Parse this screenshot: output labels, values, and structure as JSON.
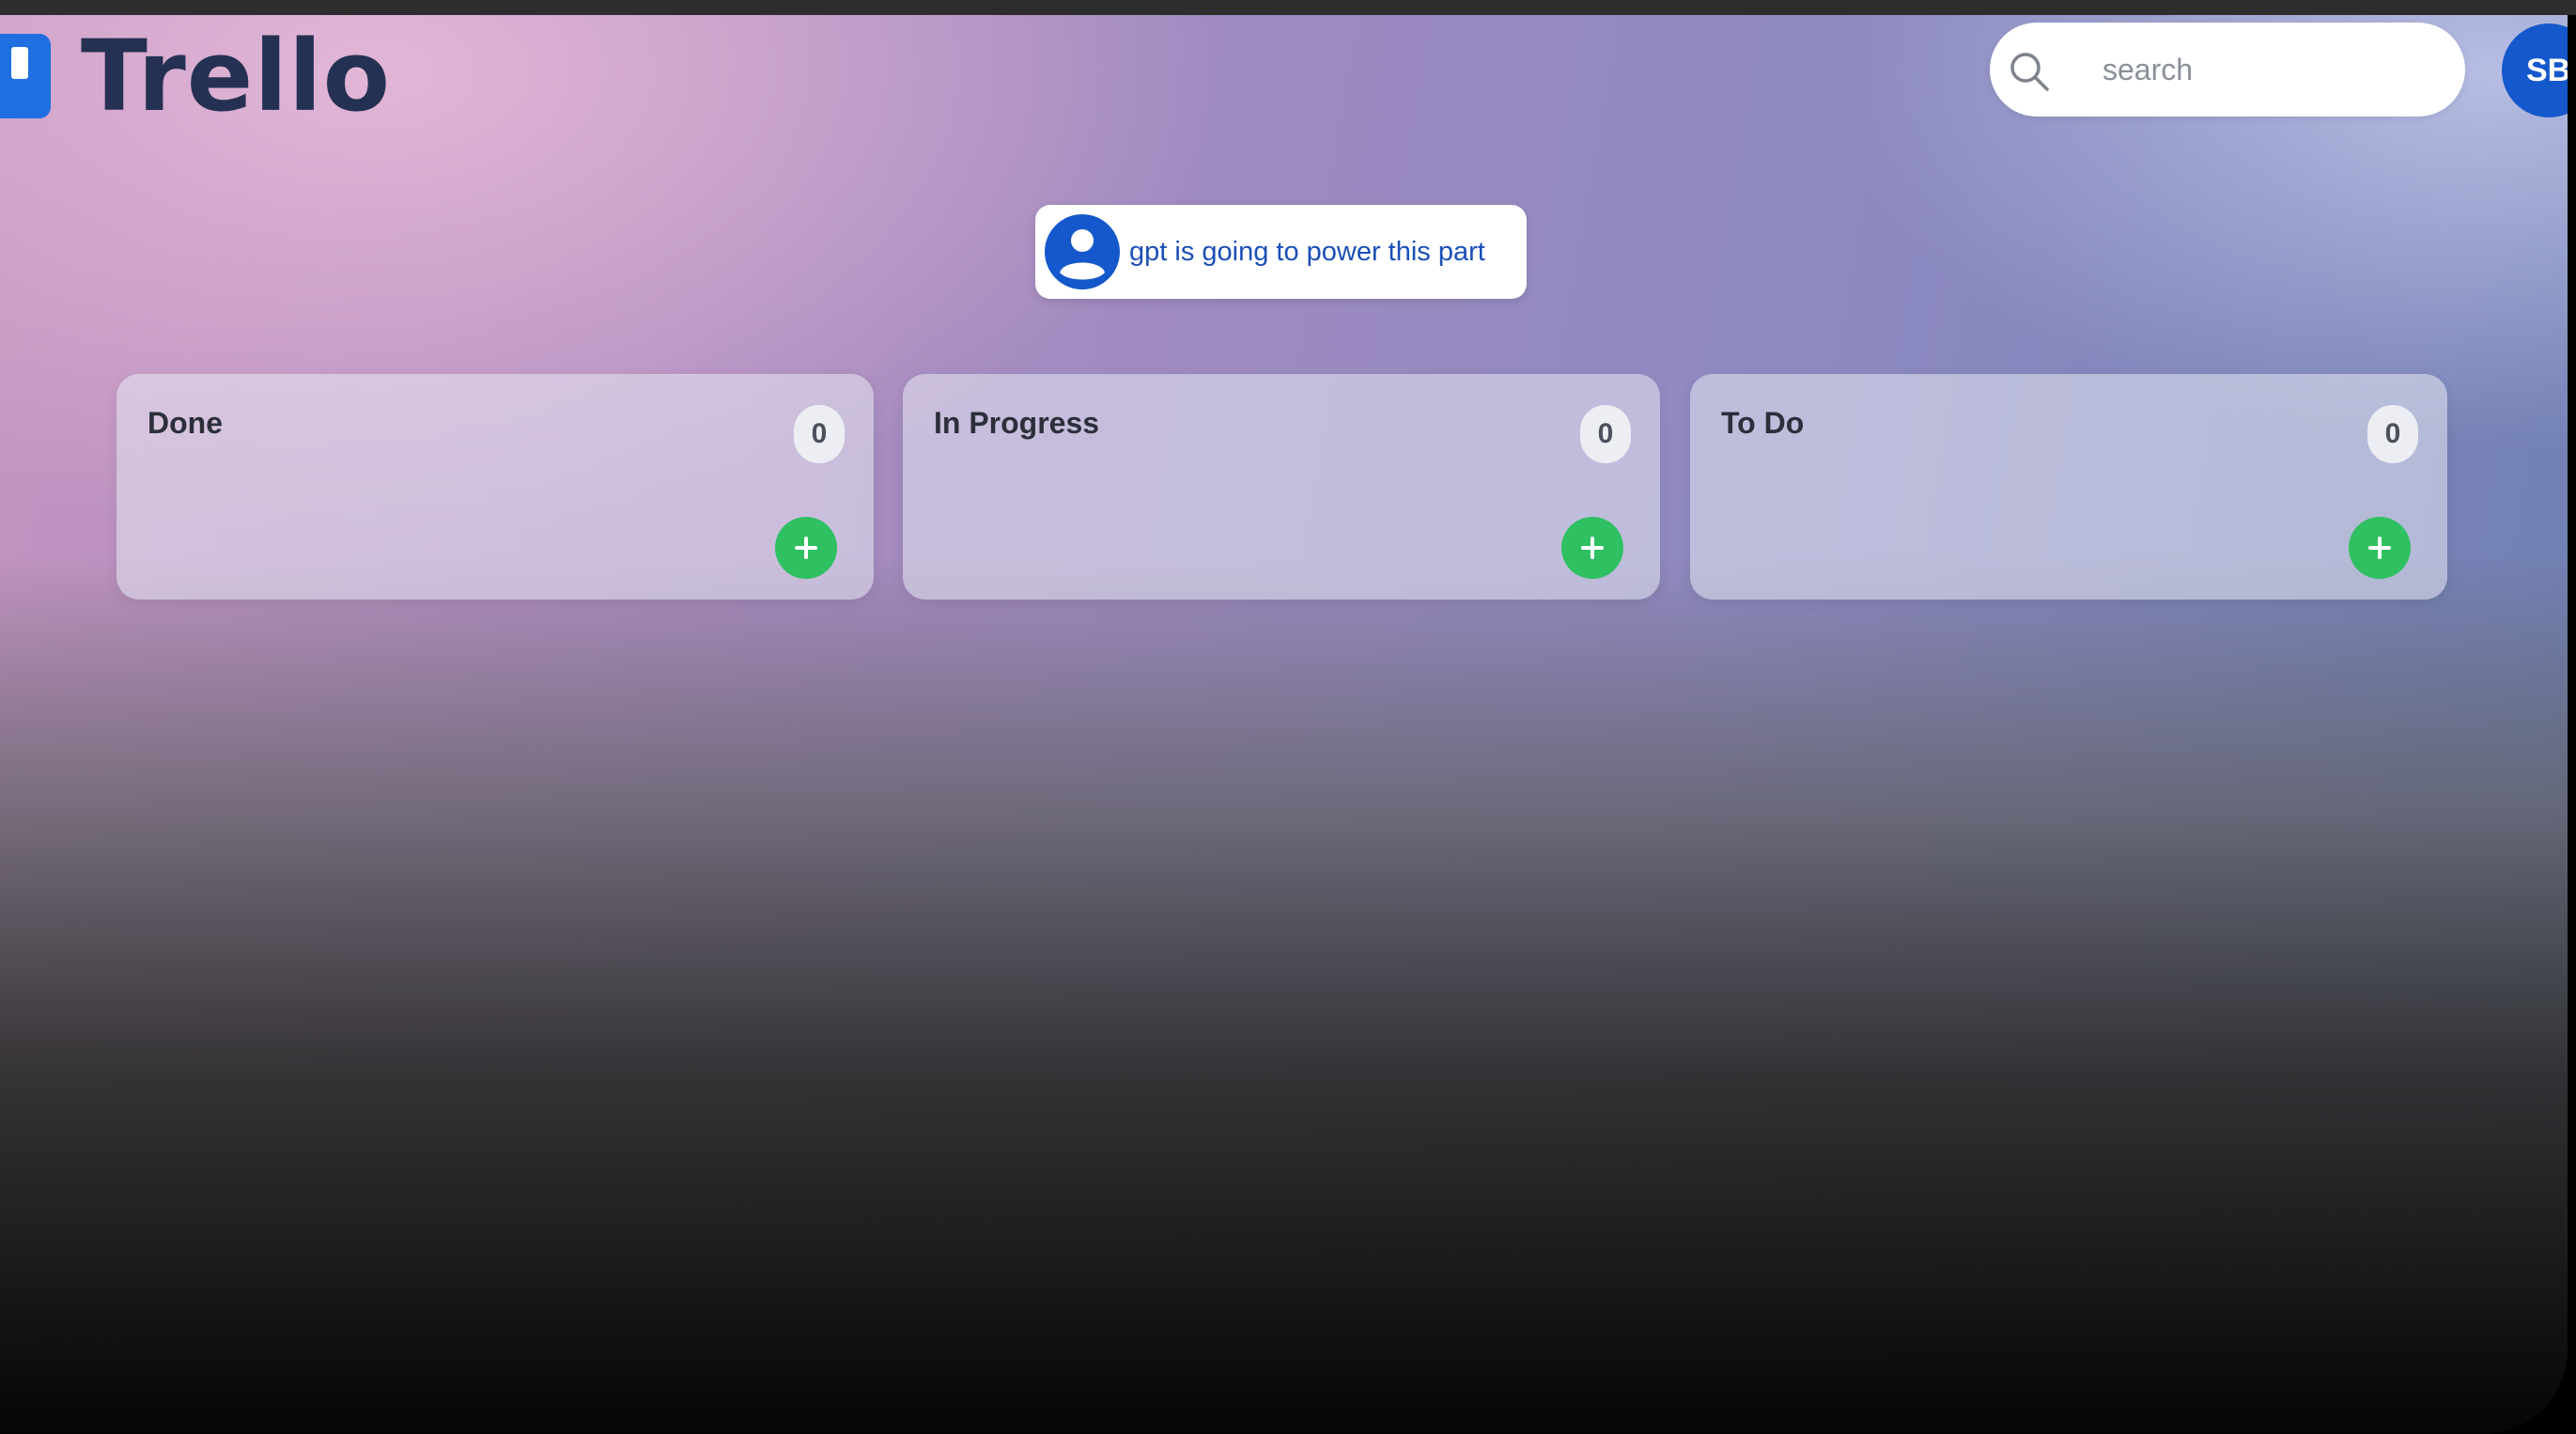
{
  "app": {
    "logo_text": "Trello"
  },
  "header": {
    "search_placeholder": "search",
    "avatar_initials": "SB"
  },
  "banner": {
    "text": "gpt is going to power this part"
  },
  "columns": [
    {
      "title": "Done",
      "count": "0"
    },
    {
      "title": "In Progress",
      "count": "0"
    },
    {
      "title": "To Do",
      "count": "0"
    }
  ],
  "icons": {
    "logo": "trello-logo-icon",
    "search": "search-icon",
    "user": "user-circle-icon",
    "add": "plus-icon"
  },
  "colors": {
    "accent_blue": "#1558cc",
    "add_button_green": "#2fc061",
    "logo_text": "#243152"
  }
}
